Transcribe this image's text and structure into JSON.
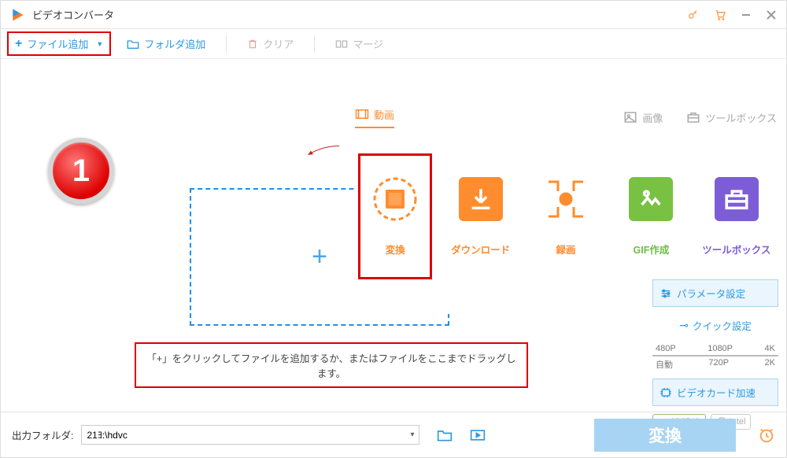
{
  "app": {
    "title": "ビデオコンバータ"
  },
  "toolbar": {
    "add_file": "ファイル追加",
    "add_folder": "フォルダ追加",
    "clear": "クリア",
    "merge": "マージ"
  },
  "badge": {
    "number": "1"
  },
  "dropzone": {
    "hint": "「+」をクリックしてファイルを追加するか、またはファイルをここまでドラッグします。"
  },
  "panel": {
    "tabs": {
      "video": "動画",
      "image": "画像",
      "toolbox": "ツールボックス"
    },
    "cards": {
      "convert": "変換",
      "download": "ダウンロード",
      "record": "録画",
      "gif": "GIF作成",
      "toolbox": "ツールボックス"
    }
  },
  "side": {
    "param": "パラメータ設定",
    "quick": "クイック設定",
    "ruler_top": [
      "480P",
      "1080P",
      "4K"
    ],
    "ruler_bot": [
      "自動",
      "720P",
      "2K"
    ],
    "gpu_title": "ビデオカード加速",
    "gpu_nvidia": "NVIDIA",
    "gpu_intel": "Intel"
  },
  "footer": {
    "label": "出力フォルダ:",
    "path": "21ﾖ:\\hdvc",
    "convert": "変換"
  }
}
